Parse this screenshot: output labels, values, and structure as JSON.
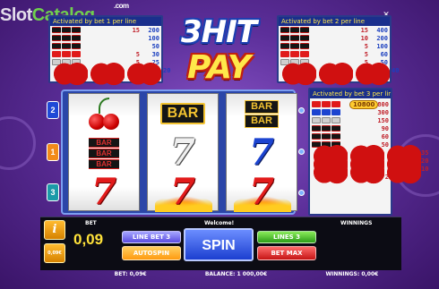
{
  "watermark": {
    "text_main": "Slot",
    "text_accent": "Catalog",
    "dotcom": ".com"
  },
  "window": {
    "close_glyph": "✕"
  },
  "logo": {
    "line1": "3HIT",
    "line2": "PAY"
  },
  "paytable_left": {
    "header": "Activated by bet 1 per line",
    "rows": [
      {
        "symbols": [
          "bar",
          "bar",
          "bar"
        ],
        "value": "15",
        "value2": "200"
      },
      {
        "symbols": [
          "bar",
          "bar",
          "bar"
        ],
        "value": "",
        "value2": "100"
      },
      {
        "symbols": [
          "bar",
          "bar",
          "bar"
        ],
        "value": "",
        "value2": "50"
      },
      {
        "symbols": [
          "seven-red",
          "seven-red",
          "seven-red"
        ],
        "value": "5",
        "value2": "30"
      },
      {
        "symbols": [
          "seven-white",
          "seven-white",
          "seven-white"
        ],
        "value": "5",
        "value2": "25"
      },
      {
        "symbols": [
          "cherry",
          "cherry",
          "cherry"
        ],
        "value": "",
        "value2": "20"
      },
      {
        "any": "ANY",
        "value": "1",
        "value2": "2"
      }
    ]
  },
  "paytable_right_top": {
    "header": "Activated by bet 2 per line",
    "rows": [
      {
        "value": "15",
        "value2": "400"
      },
      {
        "value": "10",
        "value2": "200"
      },
      {
        "value": "5",
        "value2": "100"
      },
      {
        "value": "5",
        "value2": "60"
      },
      {
        "value": "5",
        "value2": "50"
      },
      {
        "value": "",
        "value2": "40"
      },
      {
        "any": "ANY",
        "value": "2",
        "value2": "4"
      }
    ]
  },
  "paytable_right_bottom": {
    "header": "Activated by bet 3 per line",
    "jackpot": "10800",
    "rows": [
      {
        "value": "800"
      },
      {
        "value": "300"
      },
      {
        "value": "150"
      },
      {
        "value": "90"
      },
      {
        "value": "60"
      },
      {
        "value": "50"
      },
      {
        "value": "35"
      },
      {
        "value": "20"
      },
      {
        "value": "10"
      },
      {
        "any": "ANY",
        "value": "2"
      }
    ]
  },
  "reels": [
    {
      "top": "cherry",
      "middle": "triple-bar",
      "bottom": "seven-red"
    },
    {
      "top": "bar",
      "middle": "seven-white",
      "bottom": "seven-red-flames"
    },
    {
      "top": "double-bar",
      "middle": "seven-blue",
      "bottom": "seven-red-flames"
    }
  ],
  "symbol_text": {
    "bar": "BAR",
    "seven": "7"
  },
  "line_markers": {
    "left": [
      "2",
      "1",
      "3"
    ]
  },
  "controls": {
    "info_label": "i",
    "coin_label": "0,09€",
    "bet_label": "BET",
    "bet_value": "0,09",
    "welcome": "Welcome!",
    "line_bet_label": "LINE BET 3",
    "autospin_label": "AUTOSPIN",
    "spin_label": "SPIN",
    "lines_label": "LINES 3",
    "bet_max_label": "BET MAX",
    "winnings_label": "WINNINGS"
  },
  "status": {
    "bet": "BET: 0,09€",
    "balance": "BALANCE: 1 000,00€",
    "winnings": "WINNINGS: 0,00€"
  },
  "colors": {
    "background": "#5c2f9a",
    "accent_yellow": "#ffe23a",
    "spin_blue": "#1c3fd0"
  }
}
